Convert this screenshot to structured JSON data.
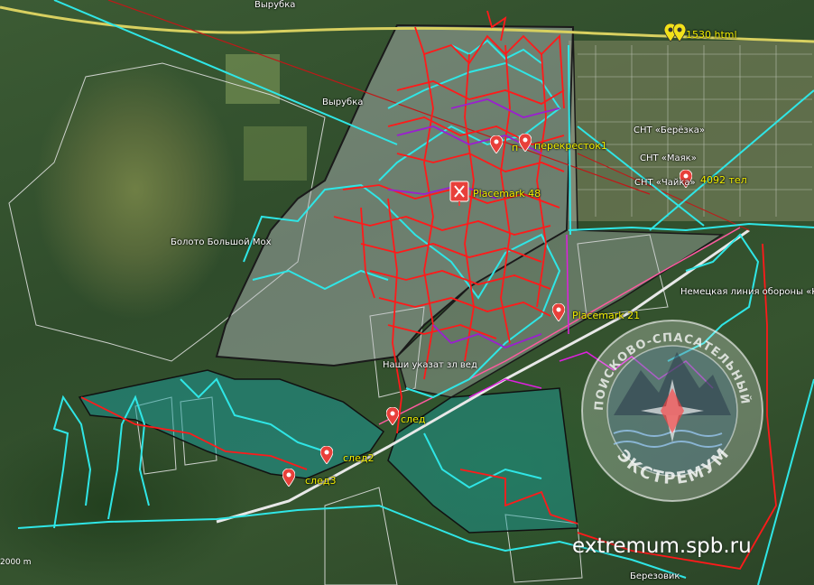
{
  "map": {
    "labels": {
      "vyrubka_top": "Вырубка",
      "vyrubka": "Вырубка",
      "boloto": "Болото Большой Мох",
      "snt_berezka": "СНТ «Берёзка»",
      "snt_mayak": "СНТ «Маяк»",
      "snt_chaika": "СНТ «Чайка»",
      "nemetskaya": "Немецкая линия обороны «Ку",
      "nashi_ukazat": "Наши указат  зл  вед",
      "berezovik": "Березовик"
    },
    "placemarks": {
      "perekrestok": "перекресток1",
      "perekrestok_prefix": "п",
      "placemark48": "Placemark 48",
      "placemark21": "Placemark 21",
      "tel": "4092  тел",
      "topright": "1530 html",
      "sled": "след",
      "sled2": "след2",
      "sled3": "след3"
    },
    "scale": "2000 m",
    "watermark": "extremum.spb.ru",
    "logo": {
      "arc_top": "ПОИСКОВО-СПАСАТЕЛЬНЫЙ ОТРЯД",
      "name": "ЭКСТРЕМУМ"
    },
    "colors": {
      "track_red": "#ff1a1a",
      "track_cyan": "#2fe6e6",
      "track_purple": "#9b1fd0",
      "track_magenta": "#e020e0",
      "road_yellow": "#d8d060",
      "area_gray": "#b9bcc0",
      "area_teal": "#1aa0a0",
      "label_yellow": "#f2f000"
    }
  }
}
